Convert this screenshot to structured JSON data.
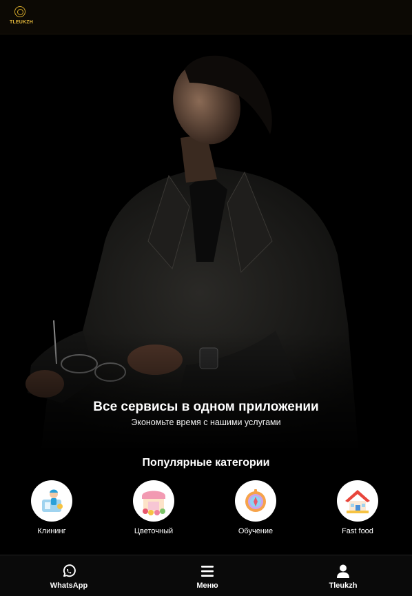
{
  "header": {
    "logo_text": "TLEUKZH",
    "logo_icon": "brand-ring-logo"
  },
  "hero": {
    "title": "Все сервисы в одном приложении",
    "subtitle": "Экономьте время с нашими услугами"
  },
  "categories": {
    "title": "Популярные категории",
    "items": [
      {
        "label": "Клининг",
        "icon": "cleaning-icon"
      },
      {
        "label": "Цветочный",
        "icon": "flower-shop-icon"
      },
      {
        "label": "Обучение",
        "icon": "compass-icon"
      },
      {
        "label": "Fast food",
        "icon": "house-icon"
      }
    ]
  },
  "bottom_nav": {
    "items": [
      {
        "label": "WhatsApp",
        "icon": "whatsapp-icon"
      },
      {
        "label": "Меню",
        "icon": "menu-icon"
      },
      {
        "label": "Tleukzh",
        "icon": "user-icon"
      }
    ]
  },
  "colors": {
    "accent": "#d4a82a",
    "background": "#000000",
    "header": "#0c0904"
  }
}
